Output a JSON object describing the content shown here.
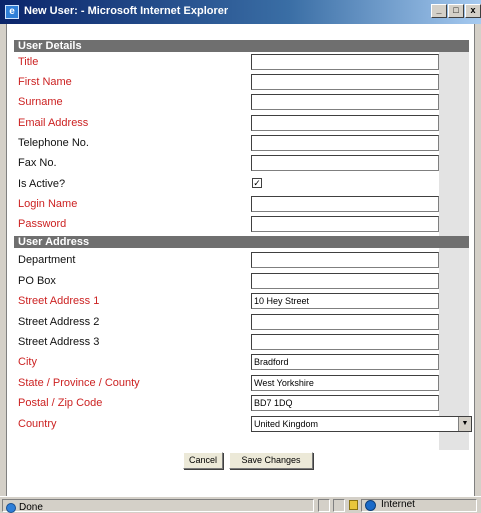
{
  "window": {
    "title": "New User: - Microsoft Internet Explorer",
    "minimize": "_",
    "maximize": "□",
    "close": "x"
  },
  "sections": {
    "details": "User Details",
    "address": "User Address"
  },
  "fields": {
    "title": {
      "label": "Title",
      "value": ""
    },
    "first_name": {
      "label": "First Name",
      "value": ""
    },
    "surname": {
      "label": "Surname",
      "value": ""
    },
    "email": {
      "label": "Email Address",
      "value": ""
    },
    "telephone": {
      "label": "Telephone No.",
      "value": ""
    },
    "fax": {
      "label": "Fax No.",
      "value": ""
    },
    "is_active": {
      "label": "Is Active?",
      "checked": true,
      "mark": "✓"
    },
    "login_name": {
      "label": "Login Name",
      "value": ""
    },
    "password": {
      "label": "Password",
      "value": ""
    },
    "department": {
      "label": "Department",
      "value": ""
    },
    "po_box": {
      "label": "PO Box",
      "value": ""
    },
    "street1": {
      "label": "Street Address 1",
      "value": "10 Hey Street"
    },
    "street2": {
      "label": "Street Address 2",
      "value": ""
    },
    "street3": {
      "label": "Street Address 3",
      "value": ""
    },
    "city": {
      "label": "City",
      "value": "Bradford"
    },
    "state": {
      "label": "State / Province / County",
      "value": "West Yorkshire"
    },
    "postal": {
      "label": "Postal / Zip Code",
      "value": "BD7 1DQ"
    },
    "country": {
      "label": "Country",
      "value": "United Kingdom",
      "arrow": "▼"
    }
  },
  "buttons": {
    "cancel": "Cancel",
    "save": "Save Changes"
  },
  "status": {
    "text": "Done",
    "zone": "Internet"
  },
  "colors": {
    "required_label": "#cc2222",
    "section_header": "#6f6f6f",
    "titlebar": "#0a246a"
  },
  "icons": [
    "ie-window-icon",
    "done-page-icon",
    "lock-icon",
    "internet-globe-icon",
    "chevron-down-icon"
  ]
}
